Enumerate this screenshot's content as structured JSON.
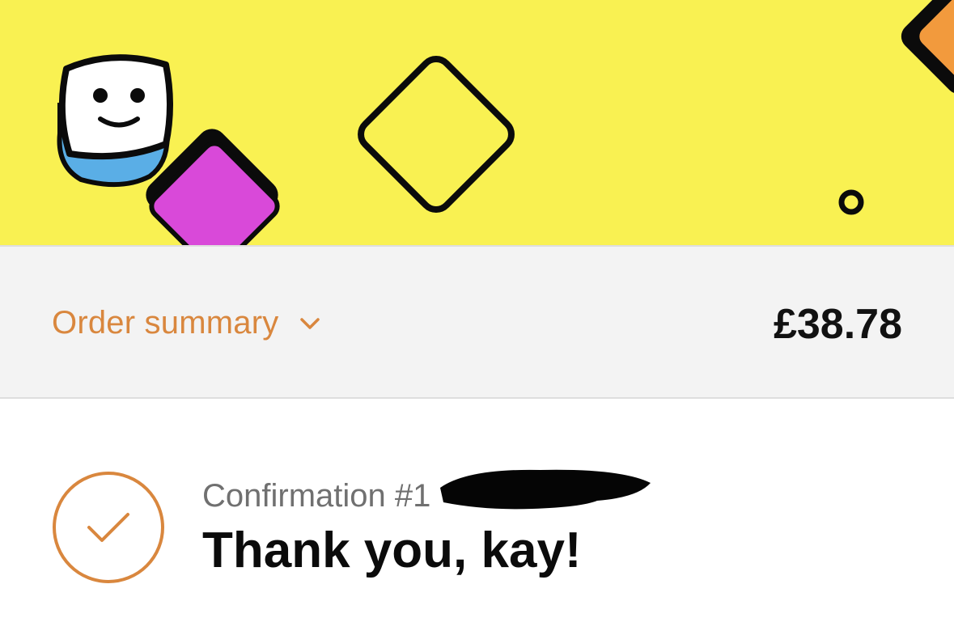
{
  "banner": {
    "background_color": "#f9f152",
    "mascot_icon": "smiling-face-icon",
    "shape_colors": {
      "magenta": "#d949d9",
      "orange": "#f29a3d",
      "outline": "#0b0b0b"
    }
  },
  "order_summary": {
    "label": "Order summary",
    "toggle_icon": "chevron-down-icon",
    "total": "£38.78",
    "accent_color": "#d9873e"
  },
  "confirmation": {
    "check_icon": "checkmark-circle-icon",
    "number_label": "Confirmation #1",
    "heading": "Thank you, kay!"
  }
}
